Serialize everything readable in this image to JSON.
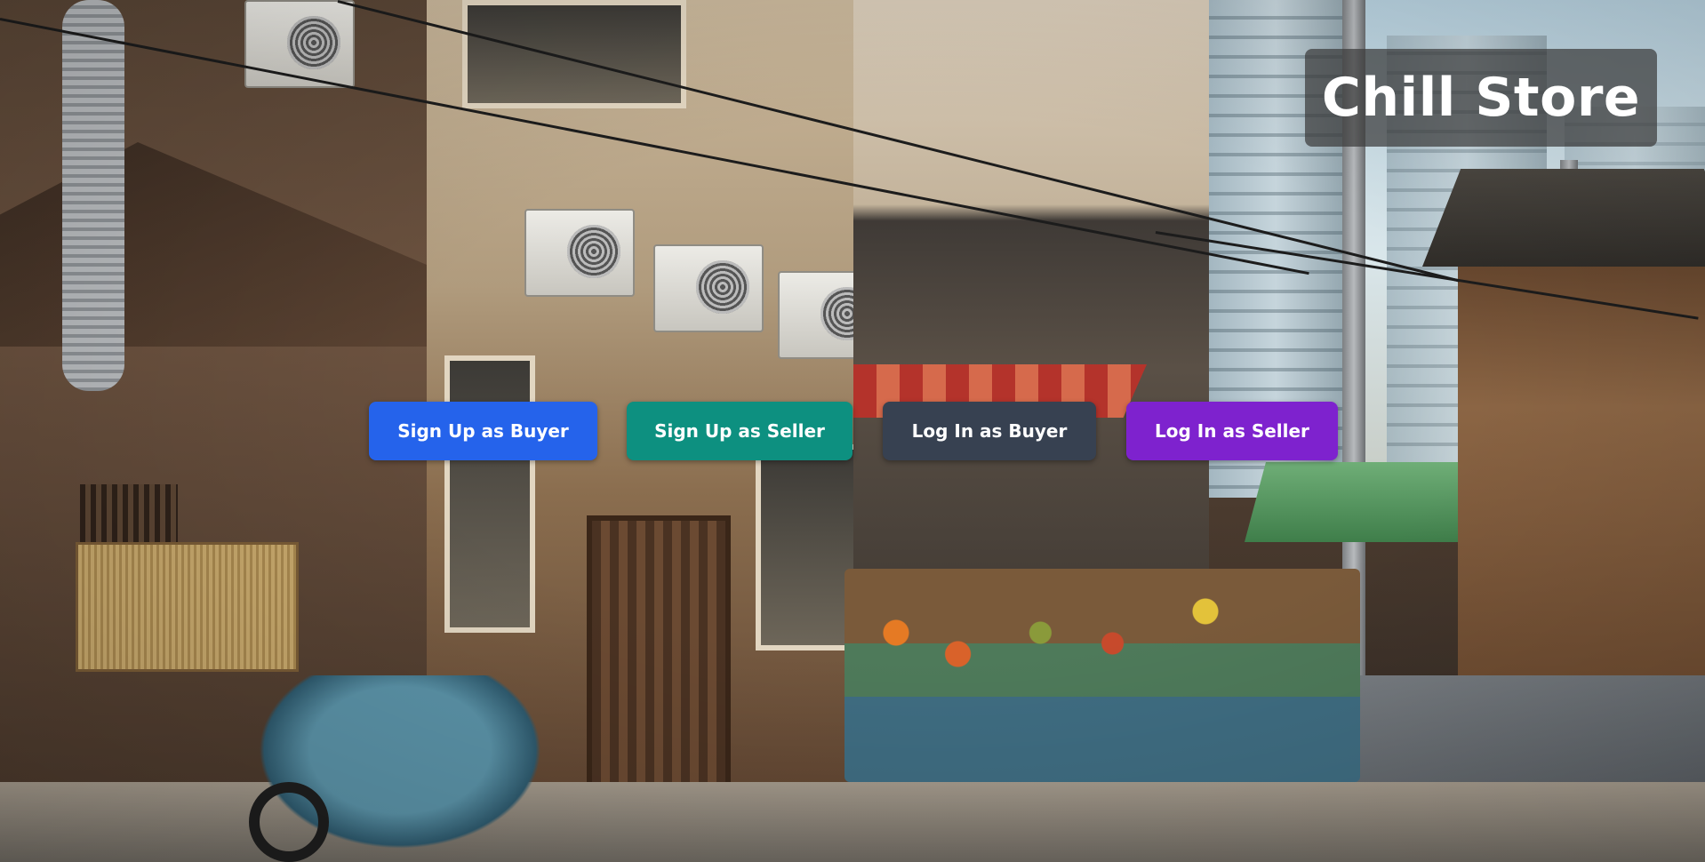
{
  "app": {
    "title": "Chill Store"
  },
  "actions": [
    {
      "label": "Sign Up as Buyer",
      "color": "#2563eb"
    },
    {
      "label": "Sign Up as Seller",
      "color": "#0d9080"
    },
    {
      "label": "Log In as Buyer",
      "color": "#374151"
    },
    {
      "label": "Log In as Seller",
      "color": "#7e22ce"
    }
  ],
  "colors": {
    "title_box": "#3c3c3c",
    "title_text": "#ffffff",
    "button_text": "#ffffff"
  }
}
